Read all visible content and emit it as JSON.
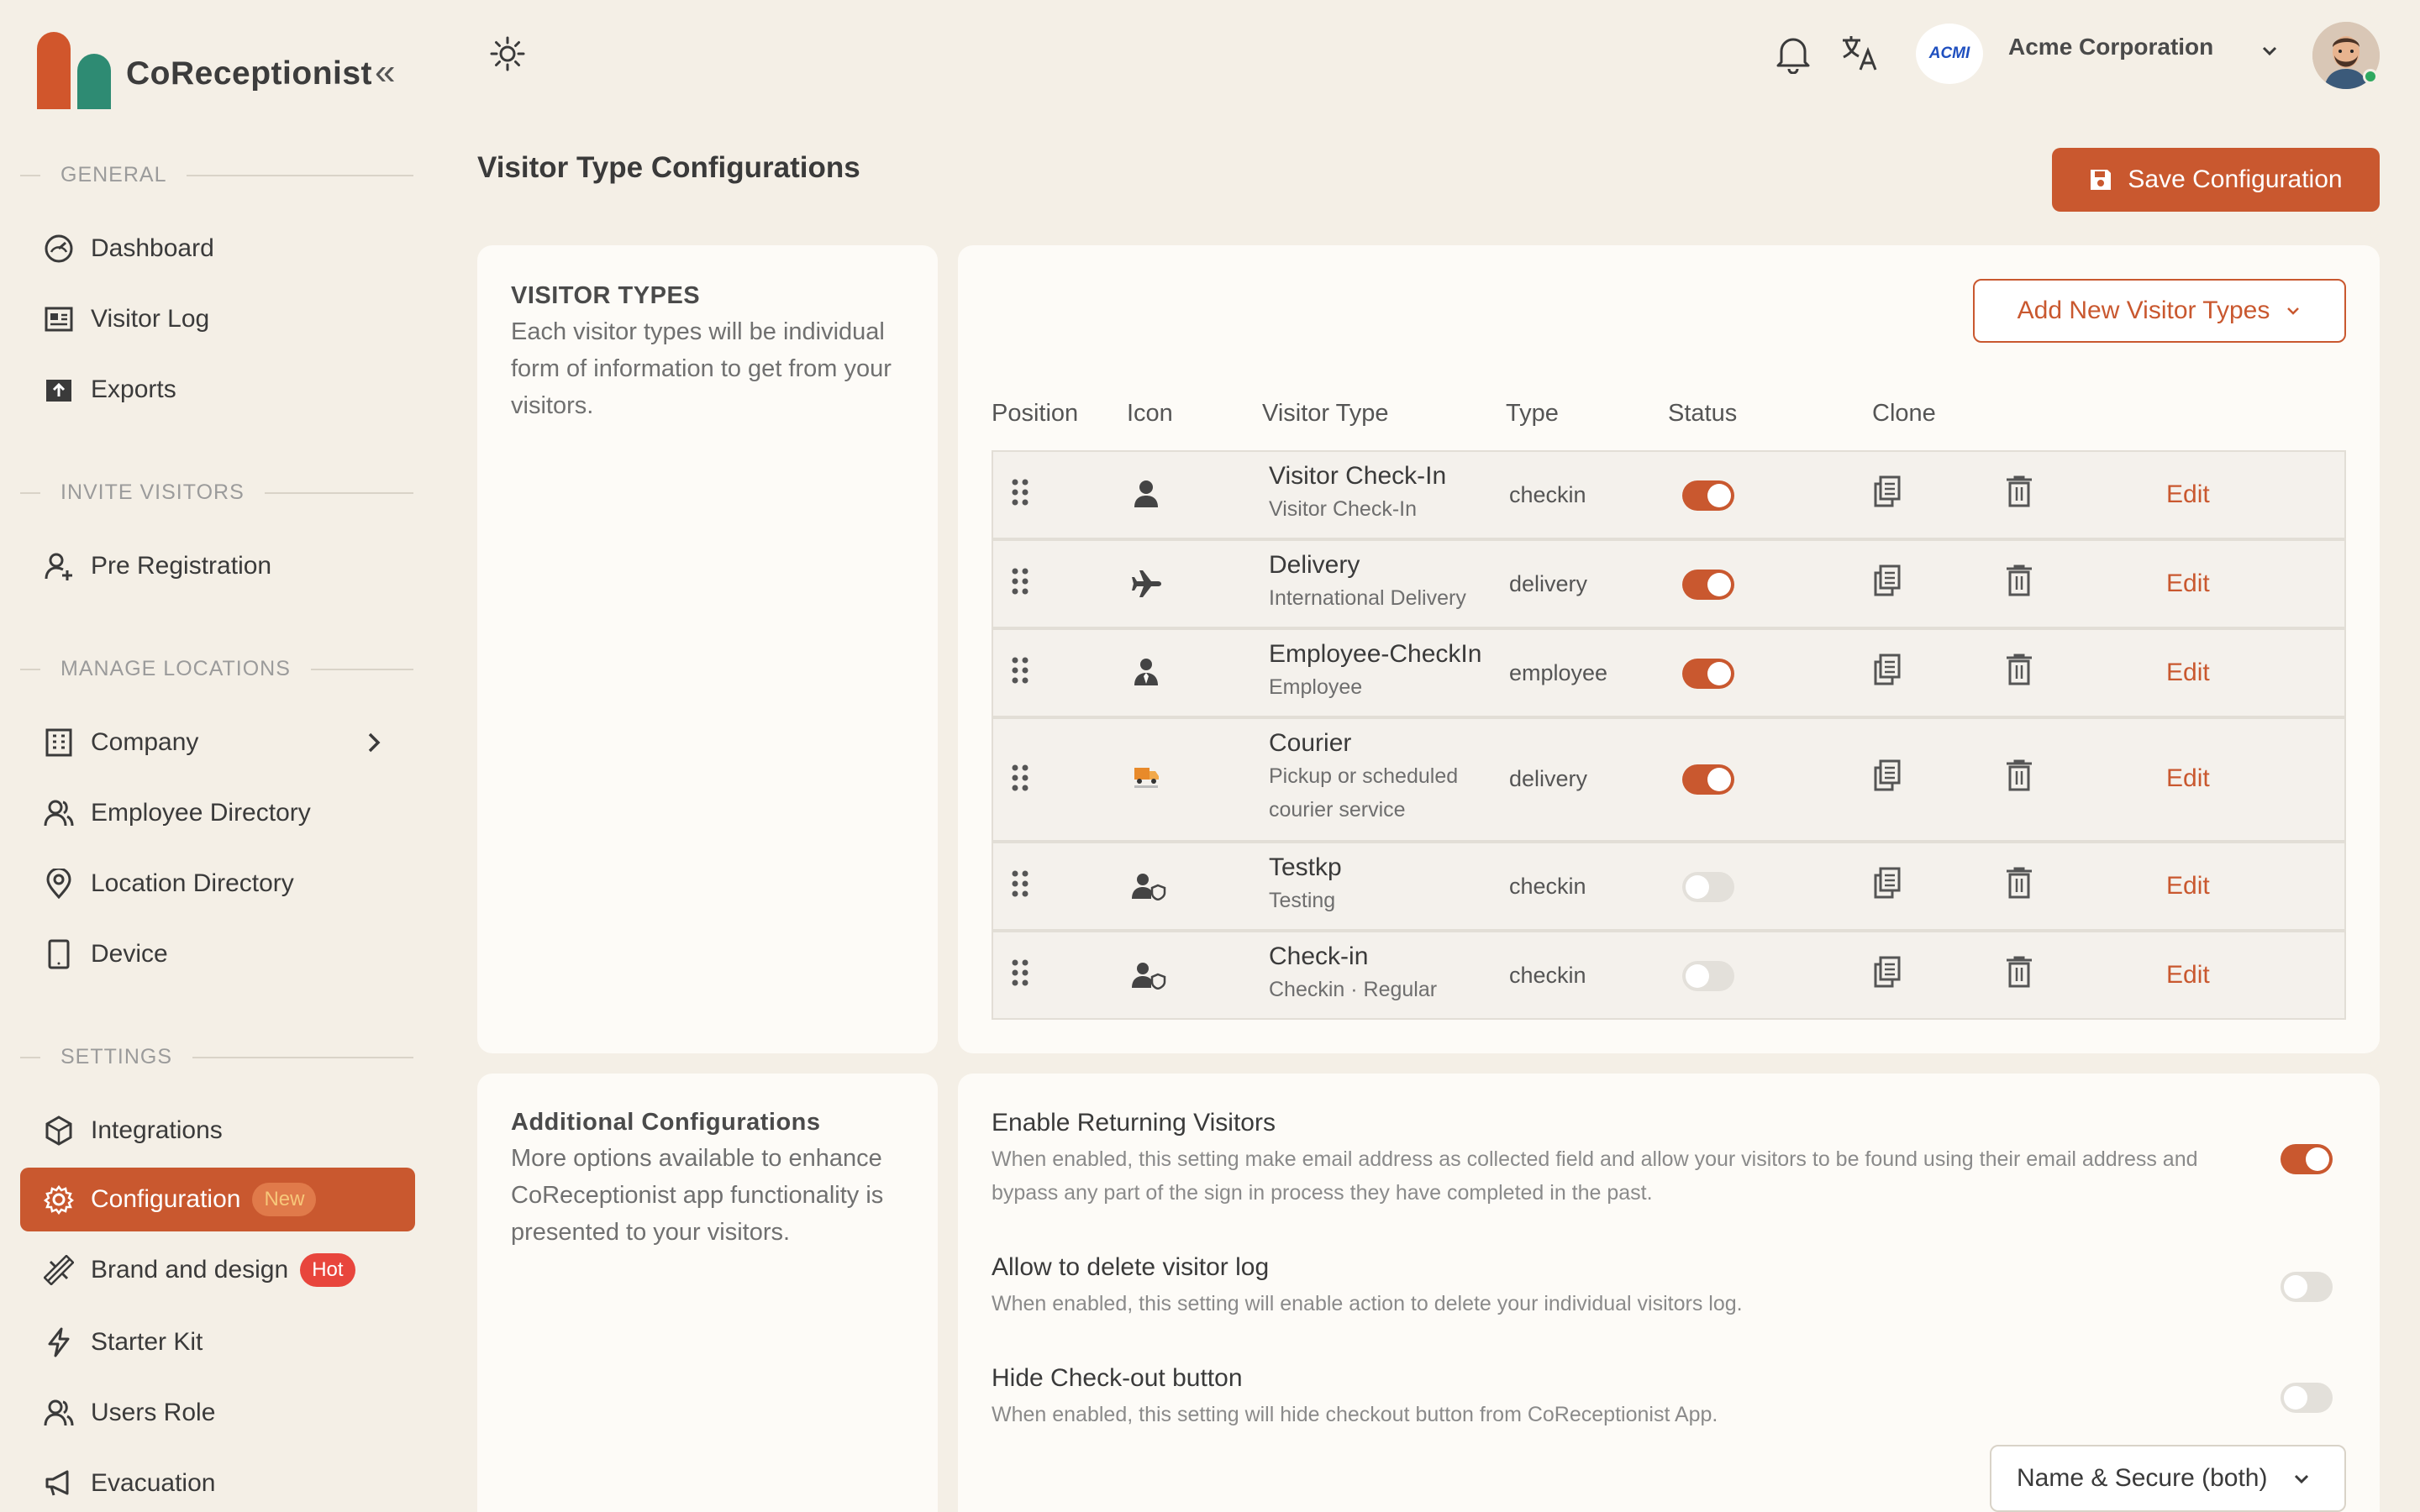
{
  "app": {
    "name": "CoReceptionist",
    "collapse_glyph": "«"
  },
  "sidebar": {
    "sections": [
      {
        "label": "GENERAL"
      },
      {
        "label": "INVITE VISITORS"
      },
      {
        "label": "MANAGE LOCATIONS"
      },
      {
        "label": "SETTINGS"
      }
    ],
    "items": [
      {
        "label": "Dashboard",
        "icon": "dashboard-icon"
      },
      {
        "label": "Visitor Log",
        "icon": "visitor-log-icon"
      },
      {
        "label": "Exports",
        "icon": "export-icon"
      },
      {
        "label": "Pre Registration",
        "icon": "user-plus-icon"
      },
      {
        "label": "Company",
        "icon": "building-icon"
      },
      {
        "label": "Employee Directory",
        "icon": "users-icon"
      },
      {
        "label": "Location Directory",
        "icon": "location-pin-icon"
      },
      {
        "label": "Device",
        "icon": "tablet-icon"
      },
      {
        "label": "Integrations",
        "icon": "integration-icon"
      },
      {
        "label": "Configuration",
        "icon": "gear-icon",
        "badge": "New",
        "active": true
      },
      {
        "label": "Brand and design",
        "icon": "design-tools-icon",
        "badge": "Hot"
      },
      {
        "label": "Starter Kit",
        "icon": "lightning-icon"
      },
      {
        "label": "Users Role",
        "icon": "users-role-icon"
      },
      {
        "label": "Evacuation",
        "icon": "megaphone-icon"
      }
    ]
  },
  "header": {
    "company_name": "Acme Corporation",
    "company_logo_text": "ACMI"
  },
  "page": {
    "title": "Visitor Type Configurations",
    "save_label": "Save Configuration"
  },
  "visitor_types_card": {
    "title": "VISITOR TYPES",
    "description": "Each visitor types will be individual form of information to get from your visitors."
  },
  "table": {
    "add_button": "Add New Visitor Types",
    "headers": [
      "Position",
      "Icon",
      "Visitor Type",
      "Type",
      "Status",
      "Clone"
    ],
    "edit_label": "Edit",
    "rows": [
      {
        "name": "Visitor Check-In",
        "sub": "Visitor Check-In",
        "type": "checkin",
        "enabled": true,
        "icon": "person-icon"
      },
      {
        "name": "Delivery",
        "sub": "International Delivery",
        "type": "delivery",
        "enabled": true,
        "icon": "airplane-icon"
      },
      {
        "name": "Employee-CheckIn",
        "sub": "Employee",
        "type": "employee",
        "enabled": true,
        "icon": "employee-icon"
      },
      {
        "name": "Courier",
        "sub": "Pickup or scheduled courier service",
        "type": "delivery",
        "enabled": true,
        "icon": "courier-truck-icon"
      },
      {
        "name": "Testkp",
        "sub": "Testing",
        "type": "checkin",
        "enabled": false,
        "icon": "user-shield-icon"
      },
      {
        "name": "Check-in",
        "sub": "Checkin · Regular",
        "type": "checkin",
        "enabled": false,
        "icon": "user-shield-icon"
      }
    ]
  },
  "additional_card": {
    "title": "Additional Configurations",
    "description": "More options available to enhance CoReceptionist app functionality is presented to your visitors."
  },
  "options": [
    {
      "title": "Enable Returning Visitors",
      "desc": "When enabled, this setting make email address as collected field and allow your visitors to be found using their email address and bypass any part of the sign in process they have completed in the past.",
      "enabled": true
    },
    {
      "title": "Allow to delete visitor log",
      "desc": "When enabled, this setting will enable action to delete your individual visitors log.",
      "enabled": false
    },
    {
      "title": "Hide Check-out button",
      "desc": "When enabled, this setting will hide checkout button from CoReceptionist App.",
      "enabled": false
    }
  ],
  "verify_select": {
    "value": "Name & Secure (both)"
  },
  "colors": {
    "accent": "#c9582f",
    "brand_green": "#2e8b73",
    "background": "#f4efe6",
    "card": "#fdfbf7"
  }
}
